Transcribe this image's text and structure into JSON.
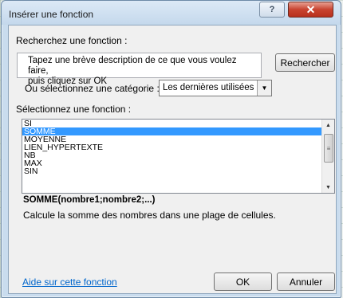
{
  "dialog": {
    "title": "Insérer une fonction",
    "help_label": "?",
    "close_label": "✕"
  },
  "search": {
    "heading": "Recherchez une fonction :",
    "text_line1": "Tapez une brève description de ce que vous voulez faire,",
    "text_line2": "puis cliquez sur OK",
    "button_label": "Rechercher"
  },
  "category": {
    "label": "Ou sélectionnez une catégorie :",
    "selected": "Les dernières utilisées"
  },
  "function_list": {
    "heading": "Sélectionnez une fonction :",
    "items": [
      "SI",
      "SOMME",
      "MOYENNE",
      "LIEN_HYPERTEXTE",
      "NB",
      "MAX",
      "SIN"
    ],
    "selected_index": 1
  },
  "description": {
    "syntax": "SOMME(nombre1;nombre2;...)",
    "text": "Calcule la somme des nombres dans une plage de cellules."
  },
  "footer": {
    "help_link": "Aide sur cette fonction",
    "ok_label": "OK",
    "cancel_label": "Annuler"
  },
  "colors": {
    "selection": "#3399ff",
    "link": "#0066cc",
    "close_button": "#c8432f"
  }
}
